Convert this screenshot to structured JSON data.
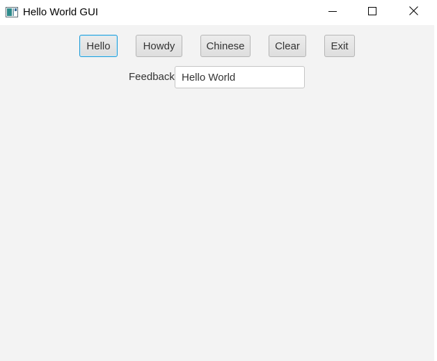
{
  "window": {
    "title": "Hello World GUI",
    "icon": "java-app-icon",
    "controls": {
      "minimize_icon": "minimize-icon",
      "maximize_icon": "maximize-icon",
      "close_icon": "close-icon"
    }
  },
  "toolbar": {
    "hello_label": "Hello",
    "howdy_label": "Howdy",
    "chinese_label": "Chinese",
    "clear_label": "Clear",
    "exit_label": "Exit"
  },
  "feedback": {
    "label": "Feedback:",
    "value": "Hello World"
  },
  "colors": {
    "background": "#f3f3f3",
    "titlebar": "#ffffff",
    "focus_border": "#1d9ad6"
  }
}
